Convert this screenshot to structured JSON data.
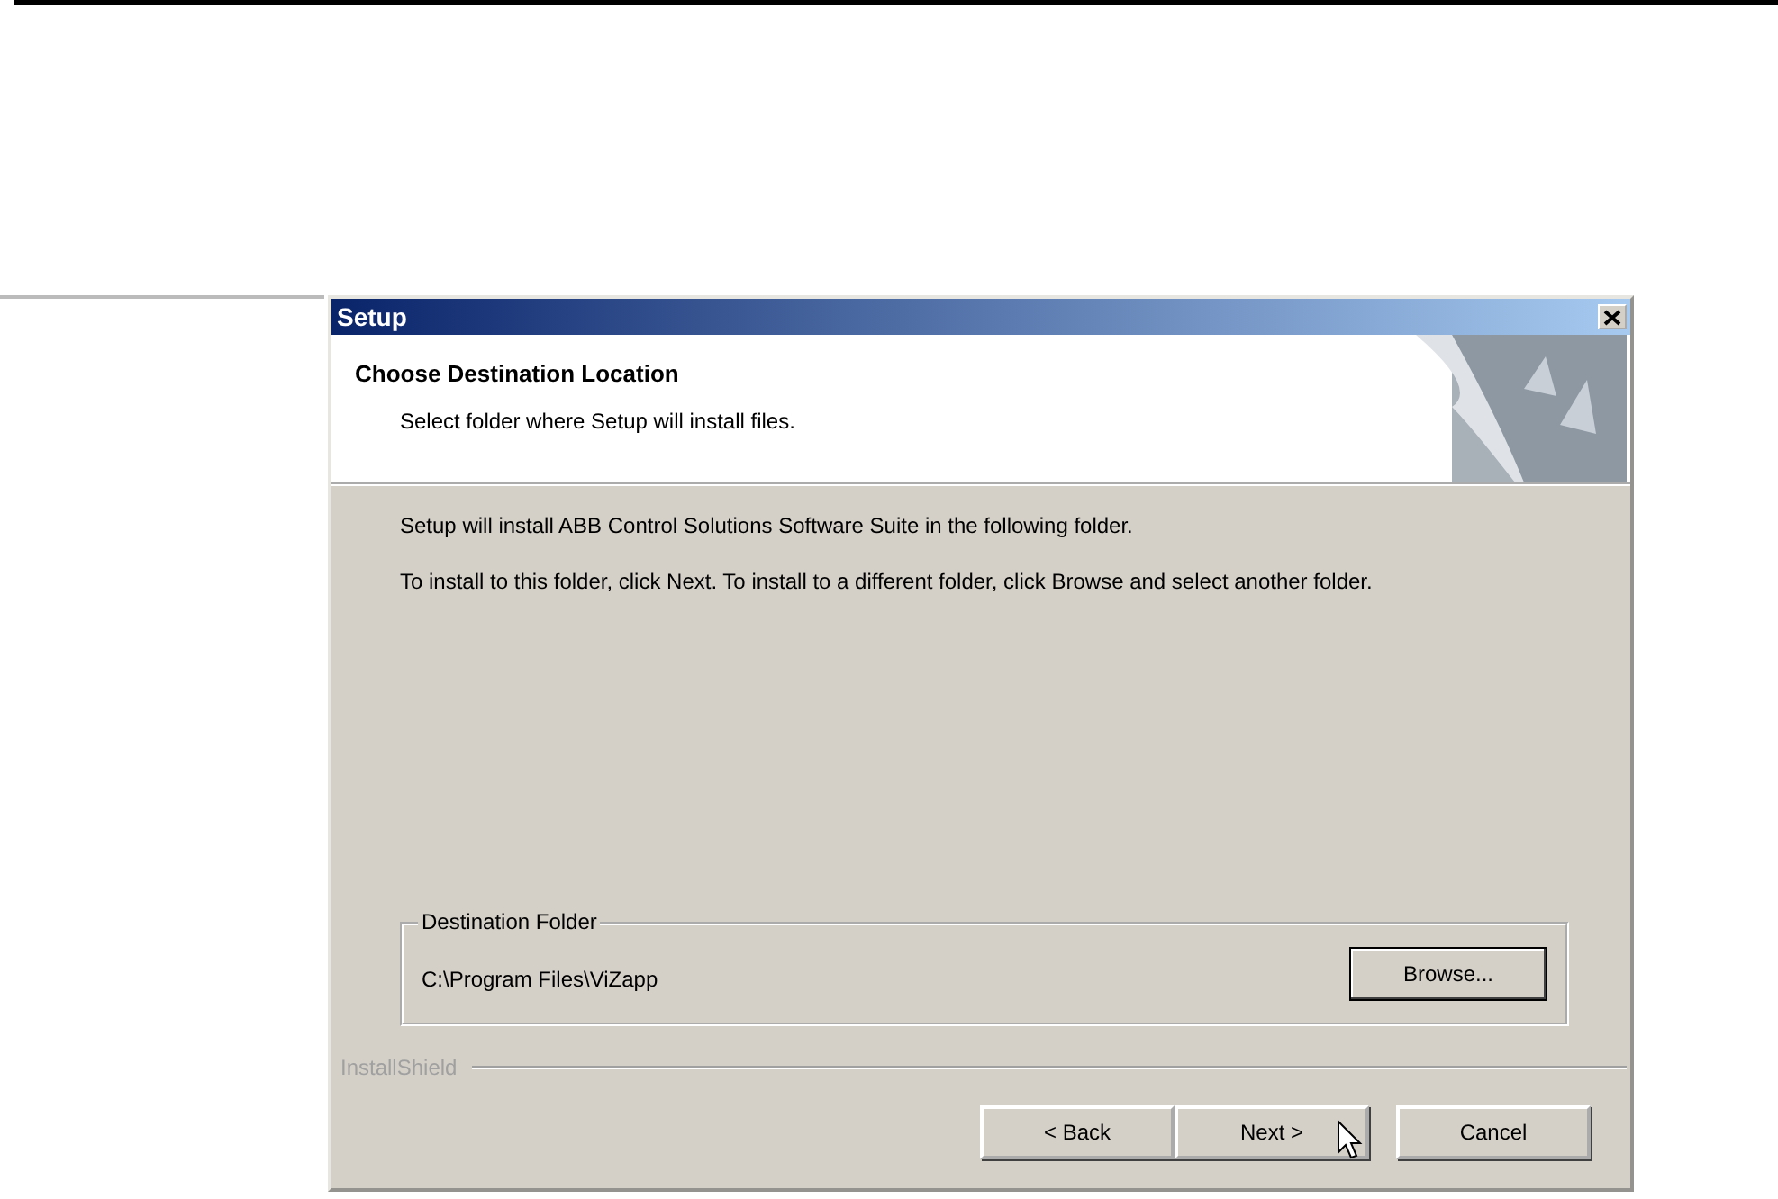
{
  "window": {
    "title": "Setup"
  },
  "header": {
    "title": "Choose Destination Location",
    "subtitle": "Select folder where Setup will install files."
  },
  "body": {
    "paragraphs": [
      "Setup will install ABB Control Solutions Software Suite in the following folder.",
      "To install to this folder, click Next. To install to a different folder, click Browse and select another folder."
    ]
  },
  "destination_folder": {
    "label": "Destination Folder",
    "path": "C:\\Program Files\\ViZapp",
    "browse_button": "Browse..."
  },
  "brand": "InstallShield",
  "buttons": [
    {
      "label": "< Back",
      "kind": "left"
    },
    {
      "label": "Next >",
      "kind": "right"
    },
    {
      "label": "Cancel",
      "kind": "single"
    }
  ]
}
